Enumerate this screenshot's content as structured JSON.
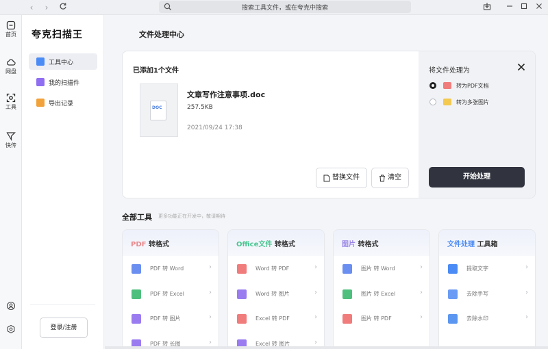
{
  "titlebar": {
    "search_placeholder": "搜索工具文件，或在夸克中搜索"
  },
  "rail": [
    {
      "label": "首页",
      "icon": "home-icon"
    },
    {
      "label": "网盘",
      "icon": "cloud-icon"
    },
    {
      "label": "工具",
      "icon": "scan-icon"
    },
    {
      "label": "快传",
      "icon": "send-icon"
    }
  ],
  "sidebar": {
    "app_title": "夸克扫描王",
    "items": [
      {
        "label": "工具中心",
        "icon": "toolbox-icon",
        "color": "#4b8bf5",
        "active": true
      },
      {
        "label": "我的扫描件",
        "icon": "scan-file-icon",
        "color": "#8f6ef2",
        "active": false
      },
      {
        "label": "导出记录",
        "icon": "export-folder-icon",
        "color": "#f2a23a",
        "active": false
      }
    ],
    "login_label": "登录/注册"
  },
  "main": {
    "page_title": "文件处理中心",
    "card": {
      "added_title": "已添加1个文件",
      "file": {
        "type_tag": "DOC",
        "name": "文章写作注意事项.doc",
        "size": "257.5KB",
        "date": "2021/09/24 17:38"
      },
      "replace_label": "替换文件",
      "clear_label": "清空",
      "process_title": "将文件处理为",
      "options": [
        {
          "label": "转为PDF文档",
          "selected": true,
          "color": "#f07c7c"
        },
        {
          "label": "转为多张图片",
          "selected": false,
          "color": "#f3c94f"
        }
      ],
      "start_label": "开始处理"
    },
    "tools": {
      "title": "全部工具",
      "subtitle": "更多功能正在开发中，敬请期待",
      "cards": [
        {
          "accent": "PDF",
          "accent_color": "#e9898c",
          "rest": " 转格式",
          "rows": [
            {
              "label": "PDF 转 Word",
              "color": "#6b8ff0"
            },
            {
              "label": "PDF 转 Excel",
              "color": "#4fbf7d"
            },
            {
              "label": "PDF 转 图片",
              "color": "#9a7cf0"
            },
            {
              "label": "PDF 转 长图",
              "color": "#9a7cf0"
            }
          ]
        },
        {
          "accent": "Office文件",
          "accent_color": "#48c58f",
          "rest": " 转格式",
          "rows": [
            {
              "label": "Word 转 PDF",
              "color": "#f07c7c"
            },
            {
              "label": "Word 转 图片",
              "color": "#9a7cf0"
            },
            {
              "label": "Excel 转 PDF",
              "color": "#f07c7c"
            },
            {
              "label": "Excel 转 图片",
              "color": "#9a7cf0"
            }
          ]
        },
        {
          "accent": "图片",
          "accent_color": "#9b86e6",
          "rest": " 转格式",
          "rows": [
            {
              "label": "图片 转 Word",
              "color": "#6b8ff0"
            },
            {
              "label": "图片 转 Excel",
              "color": "#4fbf7d"
            },
            {
              "label": "图片 转 PDF",
              "color": "#f07c7c"
            }
          ]
        },
        {
          "accent": "文件处理",
          "accent_color": "#4b8bf5",
          "rest": " 工具箱",
          "rows": [
            {
              "label": "提取文字",
              "color": "#4b8bf5"
            },
            {
              "label": "去除手写",
              "color": "#6b9cf5"
            },
            {
              "label": "去除水印",
              "color": "#5b96f0"
            }
          ]
        }
      ]
    }
  }
}
